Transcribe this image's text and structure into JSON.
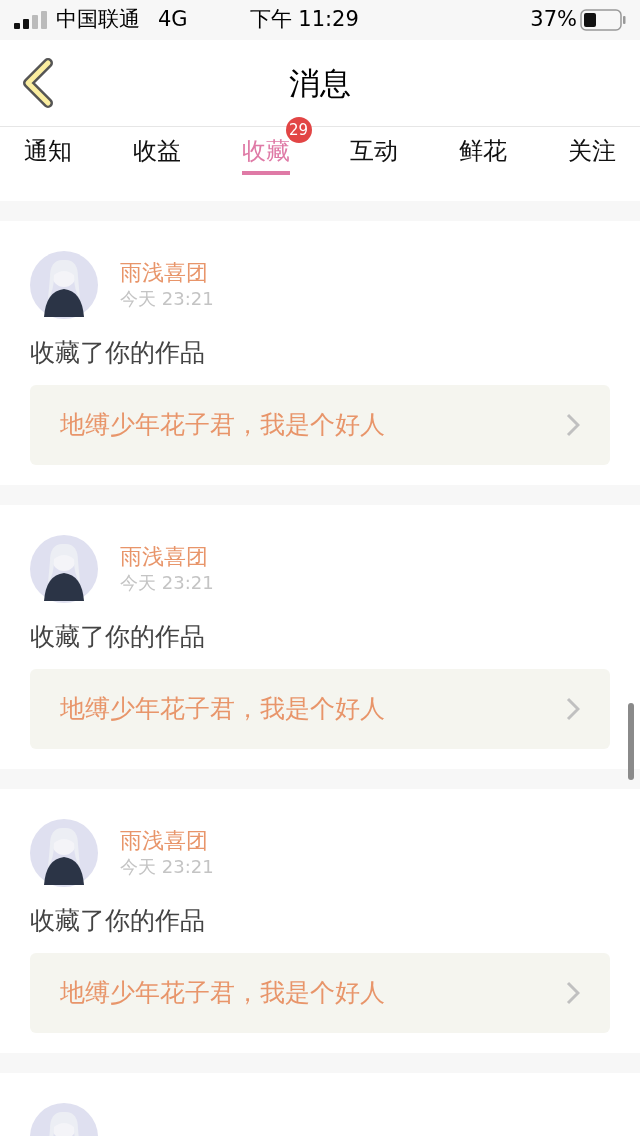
{
  "status_bar": {
    "carrier": "中国联通",
    "network": "4G",
    "time": "下午 11:29",
    "battery": "37%"
  },
  "header": {
    "title": "消息"
  },
  "tabs": [
    {
      "label": "通知",
      "selected": false
    },
    {
      "label": "收益",
      "selected": false
    },
    {
      "label": "收藏",
      "selected": true,
      "badge": "29"
    },
    {
      "label": "互动",
      "selected": false
    },
    {
      "label": "鲜花",
      "selected": false
    },
    {
      "label": "关注",
      "selected": false
    }
  ],
  "messages": [
    {
      "name": "雨浅喜团",
      "time": "今天 23:21",
      "action": "收藏了你的作品",
      "work": "地缚少年花子君，我是个好人"
    },
    {
      "name": "雨浅喜团",
      "time": "今天 23:21",
      "action": "收藏了你的作品",
      "work": "地缚少年花子君，我是个好人"
    },
    {
      "name": "雨浅喜团",
      "time": "今天 23:21",
      "action": "收藏了你的作品",
      "work": "地缚少年花子君，我是个好人"
    }
  ]
}
